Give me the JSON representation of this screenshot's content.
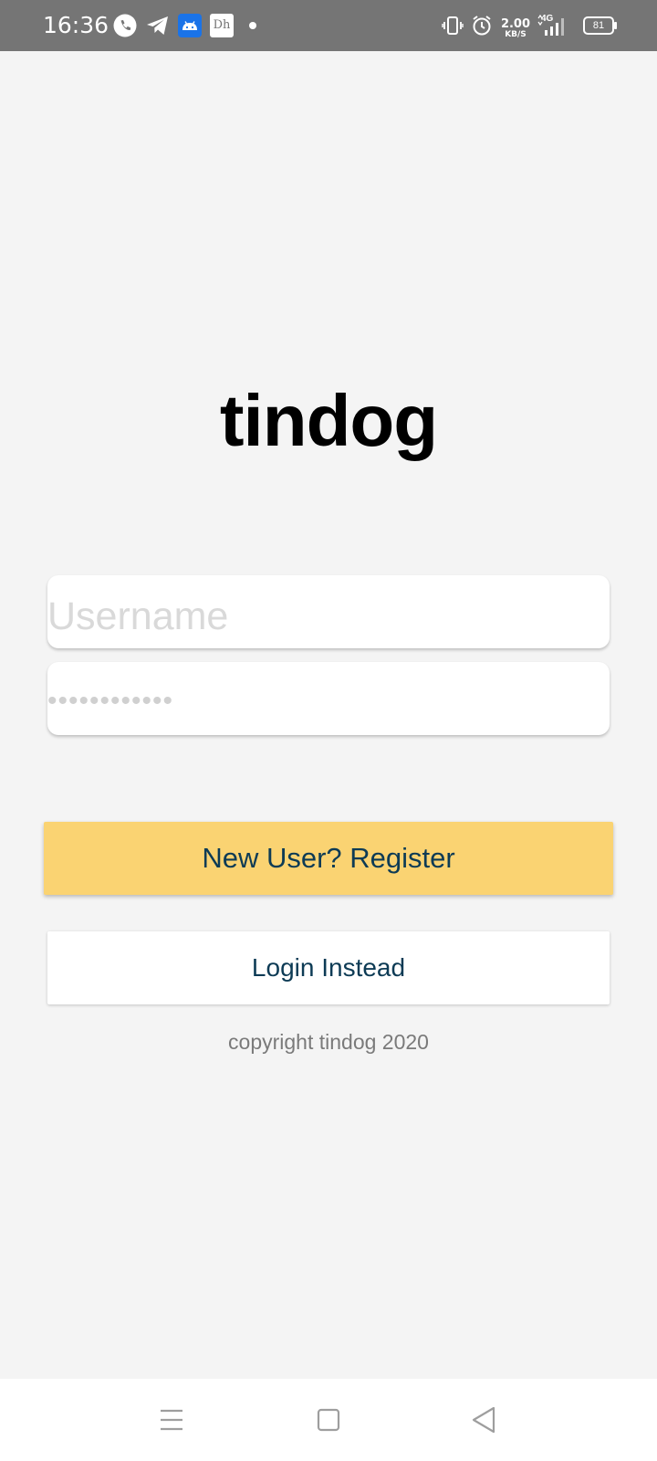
{
  "status_bar": {
    "time": "16:36",
    "notification_icons": [
      "phone-icon",
      "telegram-icon",
      "android-app-icon",
      "dh-app-icon",
      "dot-icon"
    ],
    "dh_label": "Dh",
    "network_speed_value": "2.00",
    "network_speed_unit": "KB/S",
    "network_type": "4G",
    "battery_level": "81"
  },
  "app": {
    "title": "tindog",
    "username_placeholder": "Username",
    "password_value": "••••••••••••",
    "register_label": "New User? Register",
    "login_label": "Login Instead",
    "copyright": "copyright tindog 2020"
  },
  "colors": {
    "status_bar_bg": "#757575",
    "page_bg": "#f4f4f4",
    "register_button_bg": "#fad372",
    "button_text": "#0d3b55"
  },
  "nav_bar": {
    "icons": [
      "menu-icon",
      "home-icon",
      "back-icon"
    ]
  }
}
